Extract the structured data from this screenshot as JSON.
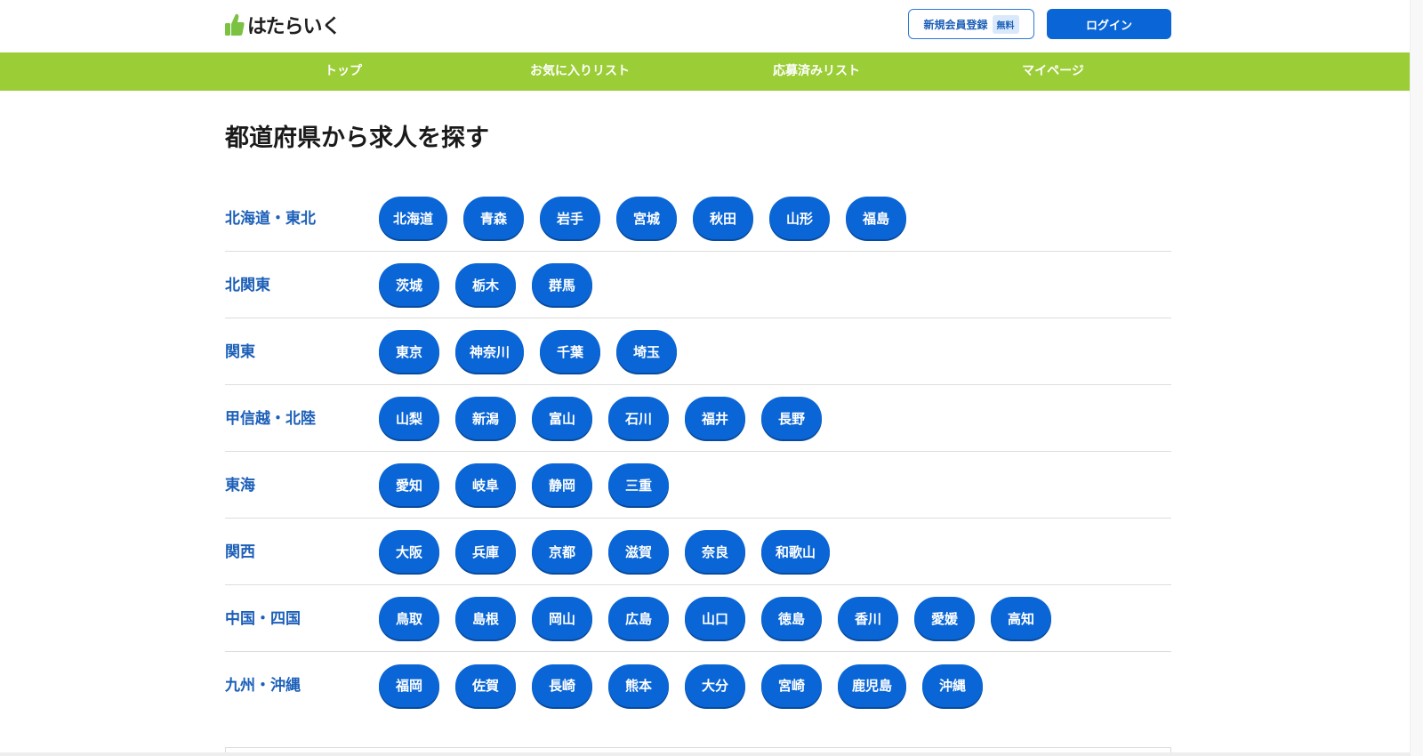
{
  "header": {
    "logo_text": "はたらいく",
    "logo_icon": "thumbs-up-icon",
    "register_label": "新規会員登録",
    "free_badge": "無料",
    "login_label": "ログイン"
  },
  "colors": {
    "accent_blue": "#0a66d6",
    "nav_green": "#9bcd36",
    "region_label": "#1c5fb8"
  },
  "nav": {
    "items": [
      "トップ",
      "お気に入りリスト",
      "応募済みリスト",
      "マイページ"
    ]
  },
  "main": {
    "title": "都道府県から求人を探す"
  },
  "regions": [
    {
      "name": "北海道・東北",
      "prefectures": [
        "北海道",
        "青森",
        "岩手",
        "宮城",
        "秋田",
        "山形",
        "福島"
      ]
    },
    {
      "name": "北関東",
      "prefectures": [
        "茨城",
        "栃木",
        "群馬"
      ]
    },
    {
      "name": "関東",
      "prefectures": [
        "東京",
        "神奈川",
        "千葉",
        "埼玉"
      ]
    },
    {
      "name": "甲信越・北陸",
      "prefectures": [
        "山梨",
        "新潟",
        "富山",
        "石川",
        "福井",
        "長野"
      ]
    },
    {
      "name": "東海",
      "prefectures": [
        "愛知",
        "岐阜",
        "静岡",
        "三重"
      ]
    },
    {
      "name": "関西",
      "prefectures": [
        "大阪",
        "兵庫",
        "京都",
        "滋賀",
        "奈良",
        "和歌山"
      ]
    },
    {
      "name": "中国・四国",
      "prefectures": [
        "鳥取",
        "島根",
        "岡山",
        "広島",
        "山口",
        "徳島",
        "香川",
        "愛媛",
        "高知"
      ]
    },
    {
      "name": "九州・沖縄",
      "prefectures": [
        "福岡",
        "佐賀",
        "長崎",
        "熊本",
        "大分",
        "宮崎",
        "鹿児島",
        "沖縄"
      ]
    }
  ]
}
